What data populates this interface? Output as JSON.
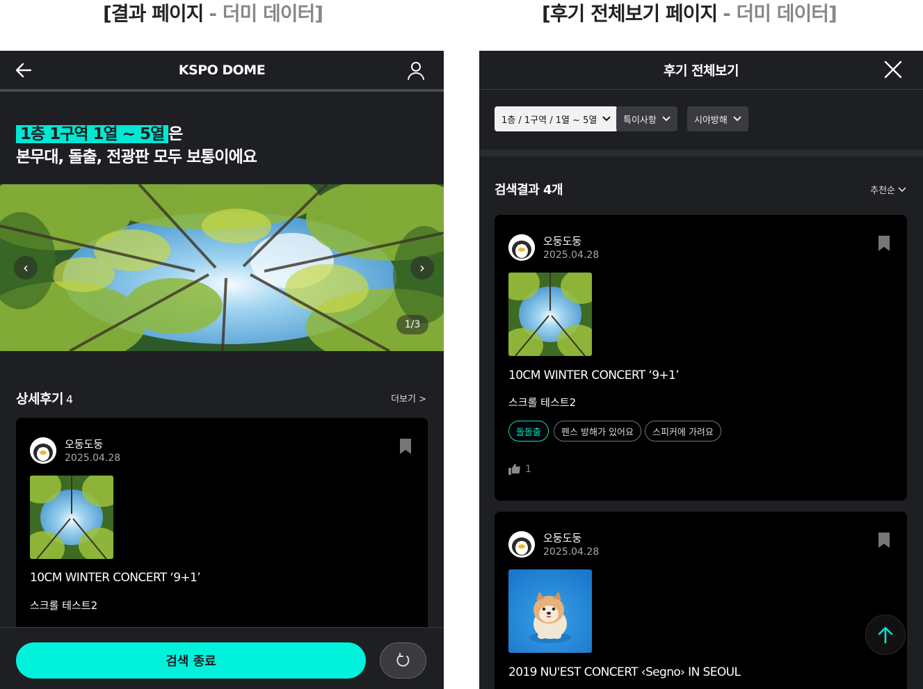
{
  "labels": {
    "left_main": "[결과 페이지",
    "left_dim": "- 더미 데이터]",
    "right_main": "[후기 전체보기 페이지",
    "right_dim": "- 더미 데이터]"
  },
  "result_page": {
    "header": {
      "title": "KSPO DOME",
      "back_icon": "arrow-left-icon",
      "profile_icon": "user-icon"
    },
    "headline": {
      "highlight": "1층 1구역 1열 ~ 5열",
      "suffix": "은",
      "line2": "본무대, 돌출, 전광판 모두 보통이에요"
    },
    "carousel": {
      "counter": "1/3",
      "prev": "‹",
      "next": "›"
    },
    "section": {
      "title": "상세후기",
      "count": "4",
      "more": "더보기 >"
    },
    "review": {
      "nickname": "오둥도둥",
      "date": "2025.04.28",
      "concert": "10CM WINTER CONCERT ‘9+1’",
      "body": "스크롤 테스트2"
    },
    "bottom": {
      "end_label": "검색 종료",
      "reset_icon": "refresh-icon"
    }
  },
  "reviews_page": {
    "header": {
      "title": "후기 전체보기",
      "close_icon": "close-icon"
    },
    "filters": [
      {
        "label": "1층 / 1구역 / 1열 ~ 5열"
      },
      {
        "label": "특이사항"
      },
      {
        "label": "시야방해"
      }
    ],
    "result_count": "검색결과 4개",
    "sort": "추천순",
    "reviews": [
      {
        "nickname": "오둥도둥",
        "date": "2025.04.28",
        "concert": "10CM WINTER CONCERT ‘9+1’",
        "body": "스크롤 테스트2",
        "tags": [
          "돌돌출",
          "펜스 방해가 있어요",
          "스피커에 가려요"
        ],
        "likes": "1"
      },
      {
        "nickname": "오둥도둥",
        "date": "2025.04.28",
        "concert": "2019 NU'EST CONCERT ‹Segno› IN SEOUL"
      }
    ],
    "fab_icon": "arrow-up-icon"
  },
  "colors": {
    "accent": "#00e8d4",
    "panel": "#1e1f22",
    "card": "#000000"
  }
}
